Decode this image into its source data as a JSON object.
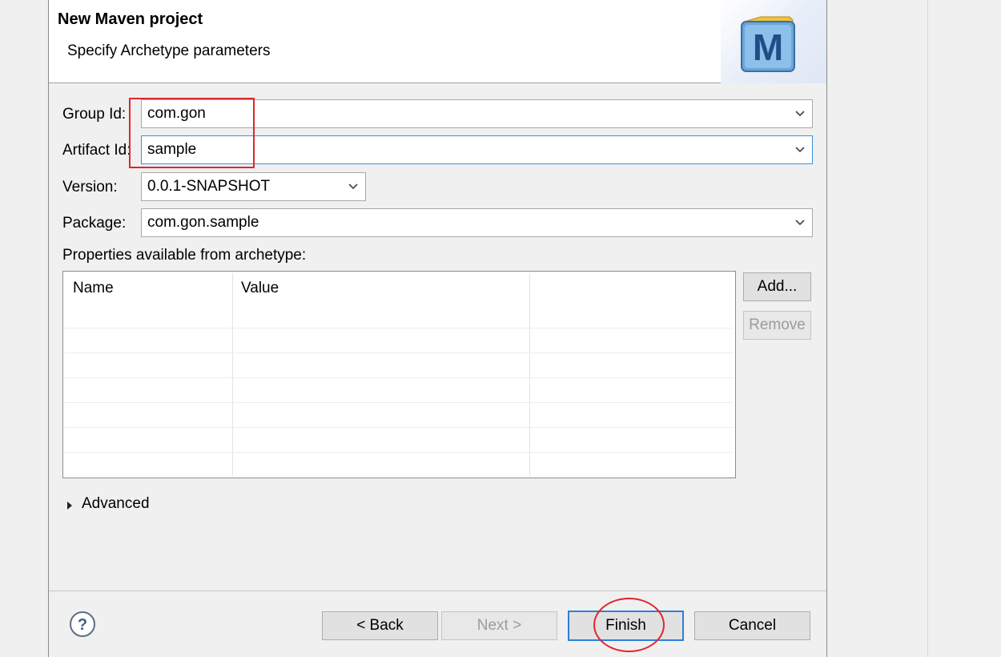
{
  "header": {
    "title": "New Maven project",
    "subtitle": "Specify Archetype parameters",
    "logo_letter": "M"
  },
  "form": {
    "group_id": {
      "label": "Group Id:",
      "value": "com.gon"
    },
    "artifact_id": {
      "label": "Artifact Id:",
      "value": "sample"
    },
    "version": {
      "label": "Version:",
      "value": "0.0.1-SNAPSHOT"
    },
    "package": {
      "label": "Package:",
      "value": "com.gon.sample"
    },
    "properties_label": "Properties available from archetype:"
  },
  "properties_table": {
    "columns": [
      "Name",
      "Value"
    ],
    "rows": []
  },
  "side_buttons": {
    "add": "Add...",
    "remove": "Remove"
  },
  "advanced": {
    "label": "Advanced",
    "expanded": false
  },
  "footer": {
    "back": "< Back",
    "next": "Next >",
    "finish": "Finish",
    "cancel": "Cancel",
    "help_icon": "question-mark-circle-icon"
  },
  "annotations": {
    "color": "#e0262a"
  }
}
